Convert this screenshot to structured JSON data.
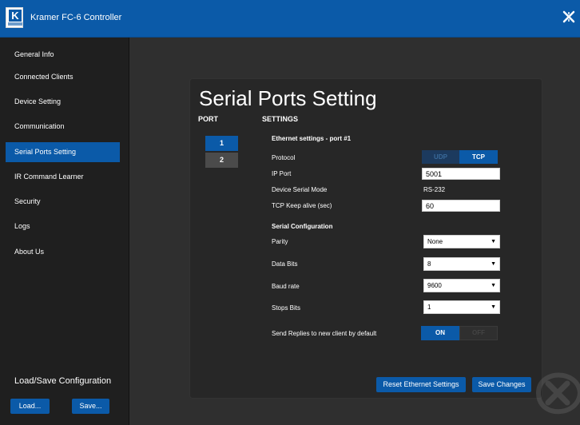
{
  "app": {
    "title": "Kramer FC-6 Controller",
    "logo_icon": "kramer-logo-icon",
    "close_icon": "close-icon"
  },
  "colors": {
    "brand": "#0b5aa8",
    "background": "#2f2f2f",
    "sidebar": "#1f1f1f",
    "panel": "#272727"
  },
  "sidebar": {
    "items": [
      {
        "label": "General Info"
      },
      {
        "label": "Connected Clients"
      },
      {
        "label": "Device Setting"
      },
      {
        "label": "Communication"
      },
      {
        "label": "Serial Ports Setting",
        "active": true
      },
      {
        "label": "IR Command Learner"
      },
      {
        "label": "Security"
      },
      {
        "label": "Logs"
      },
      {
        "label": "About Us"
      }
    ],
    "load_save_title": "Load/Save Configuration",
    "load_label": "Load...",
    "save_label": "Save..."
  },
  "page": {
    "title": "Serial Ports Setting",
    "port_header": "PORT",
    "settings_header": "SETTINGS",
    "ports": [
      "1",
      "2"
    ],
    "active_port": "1"
  },
  "ethernet": {
    "heading": "Ethernet settings - port #1",
    "protocol_label": "Protocol",
    "protocol_options": [
      "UDP",
      "TCP"
    ],
    "protocol_selected": "TCP",
    "ip_port_label": "IP Port",
    "ip_port_value": "5001",
    "serial_mode_label": "Device Serial Mode",
    "serial_mode_value": "RS-232",
    "keep_alive_label": "TCP Keep alive (sec)",
    "keep_alive_value": "60"
  },
  "serial": {
    "heading": "Serial Configuration",
    "parity_label": "Parity",
    "parity_value": "None",
    "data_bits_label": "Data Bits",
    "data_bits_value": "8",
    "baud_label": "Baud rate",
    "baud_value": "9600",
    "stop_bits_label": "Stops Bits",
    "stop_bits_value": "1",
    "send_replies_label": "Send Replies to new client by default",
    "send_replies_on": "ON",
    "send_replies_off": "OFF",
    "send_replies_state": "ON"
  },
  "actions": {
    "reset_label": "Reset Ethernet Settings",
    "save_label": "Save Changes"
  },
  "icons": {
    "dropdown": "chevron-down-icon",
    "watermark": "kramer-watermark-icon"
  }
}
